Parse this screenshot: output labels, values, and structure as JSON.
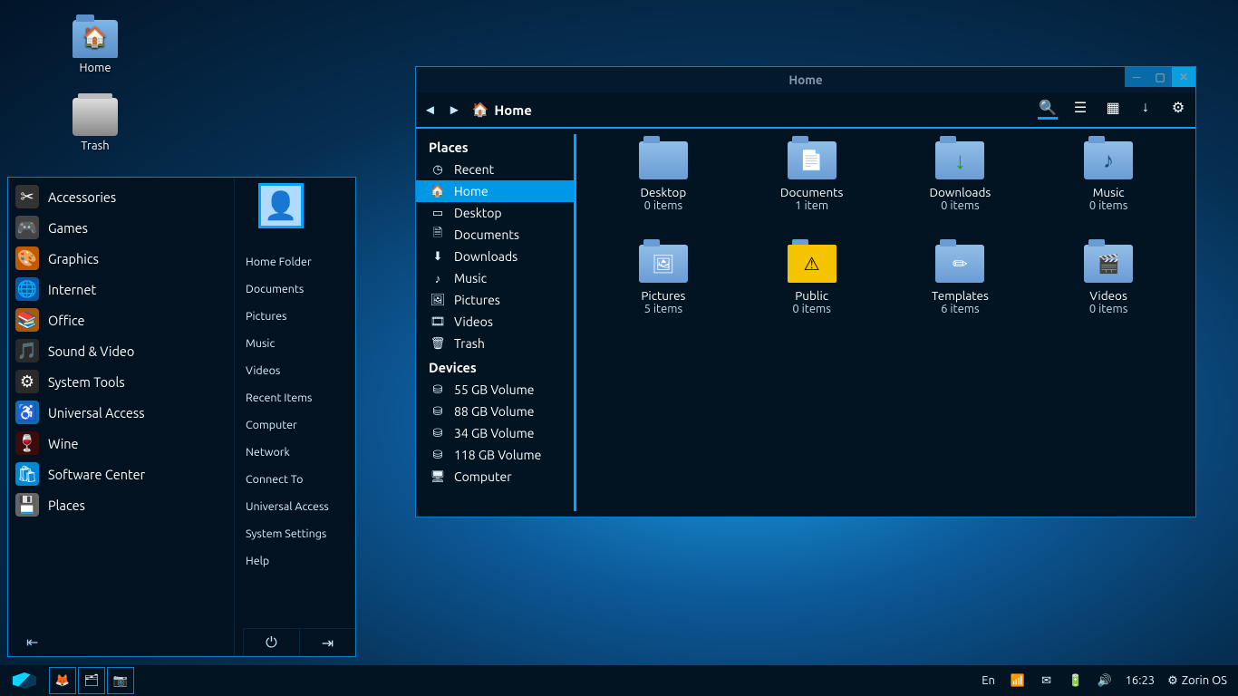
{
  "desktop": {
    "home_label": "Home",
    "trash_label": "Trash"
  },
  "startmenu": {
    "categories": [
      {
        "label": "Accessories",
        "glyph": "✂"
      },
      {
        "label": "Games",
        "glyph": "🎮"
      },
      {
        "label": "Graphics",
        "glyph": "🎨"
      },
      {
        "label": "Internet",
        "glyph": "🌐"
      },
      {
        "label": "Office",
        "glyph": "📚"
      },
      {
        "label": "Sound & Video",
        "glyph": "🎵"
      },
      {
        "label": "System Tools",
        "glyph": "⚙"
      },
      {
        "label": "Universal Access",
        "glyph": "♿"
      },
      {
        "label": "Wine",
        "glyph": "🍷"
      },
      {
        "label": "Software Center",
        "glyph": "🛍"
      },
      {
        "label": "Places",
        "glyph": "💾"
      }
    ],
    "links": [
      "Home Folder",
      "Documents",
      "Pictures",
      "Music",
      "Videos",
      "Recent Items",
      "Computer",
      "Network",
      "Connect To",
      "Universal Access",
      "System Settings",
      "Help"
    ]
  },
  "fm": {
    "title": "Home",
    "pathlabel": "Home",
    "sidebar": {
      "places_hdr": "Places",
      "devices_hdr": "Devices",
      "places": [
        {
          "label": "Recent",
          "glyph": "◷"
        },
        {
          "label": "Home",
          "glyph": "🏠",
          "selected": true
        },
        {
          "label": "Desktop",
          "glyph": "▭"
        },
        {
          "label": "Documents",
          "glyph": "🗎"
        },
        {
          "label": "Downloads",
          "glyph": "⬇"
        },
        {
          "label": "Music",
          "glyph": "♪"
        },
        {
          "label": "Pictures",
          "glyph": "🖼"
        },
        {
          "label": "Videos",
          "glyph": "🎞"
        },
        {
          "label": "Trash",
          "glyph": "🗑"
        }
      ],
      "devices": [
        {
          "label": "55 GB Volume",
          "glyph": "⛁"
        },
        {
          "label": "88 GB Volume",
          "glyph": "⛁"
        },
        {
          "label": "34 GB Volume",
          "glyph": "⛁"
        },
        {
          "label": "118 GB Volume",
          "glyph": "⛁"
        },
        {
          "label": "Computer",
          "glyph": "🖥"
        }
      ]
    },
    "folders": [
      {
        "name": "Desktop",
        "count": "0 items",
        "ov": ""
      },
      {
        "name": "Documents",
        "count": "1 item",
        "ov": "ov-doc"
      },
      {
        "name": "Downloads",
        "count": "0 items",
        "ov": "ov-dl"
      },
      {
        "name": "Music",
        "count": "0 items",
        "ov": "ov-mus"
      },
      {
        "name": "Pictures",
        "count": "5 items",
        "ov": "ov-pic"
      },
      {
        "name": "Public",
        "count": "0 items",
        "ov": "ov-pub"
      },
      {
        "name": "Templates",
        "count": "6 items",
        "ov": "ov-tpl"
      },
      {
        "name": "Videos",
        "count": "0 items",
        "ov": "ov-vid"
      }
    ]
  },
  "taskbar": {
    "lang": "En",
    "time": "16:23",
    "label": "Zorin OS"
  }
}
